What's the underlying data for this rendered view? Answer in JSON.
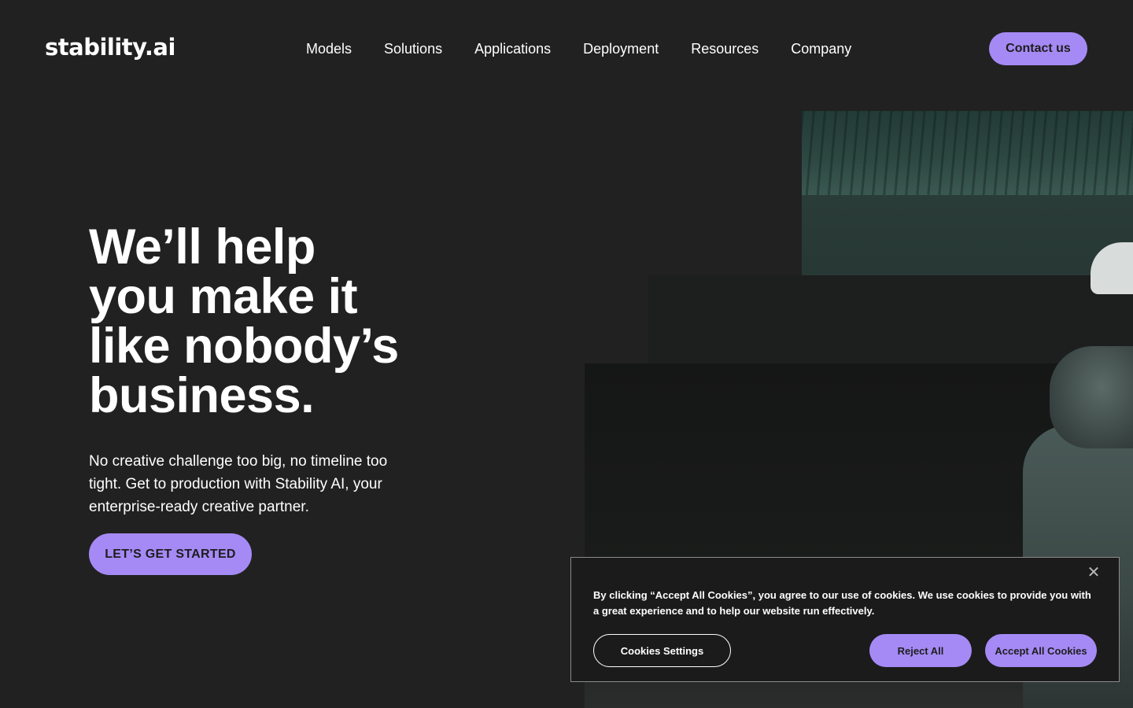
{
  "brand": {
    "logo_text": "stability.ai",
    "accent_color": "#a58af5",
    "background_color": "#212121"
  },
  "nav": {
    "items": [
      {
        "label": "Models"
      },
      {
        "label": "Solutions"
      },
      {
        "label": "Applications"
      },
      {
        "label": "Deployment"
      },
      {
        "label": "Resources"
      },
      {
        "label": "Company"
      }
    ],
    "contact_label": "Contact us"
  },
  "hero": {
    "title_lines": [
      "We’ll help",
      "you make it",
      "like nobody’s",
      "business."
    ],
    "subtitle": "No creative challenge too big, no timeline too tight. Get to production with Stability AI, your enterprise-ready creative partner.",
    "cta_label": "LET’S GET STARTED"
  },
  "cookie_banner": {
    "text": "By clicking “Accept All Cookies”, you agree to our use of cookies. We use cookies to provide you with a great experience and to help our website run effectively.",
    "close_icon": "close-icon",
    "close_glyph": "✕",
    "settings_label": "Cookies Settings",
    "reject_label": "Reject All",
    "accept_label": "Accept All Cookies"
  }
}
